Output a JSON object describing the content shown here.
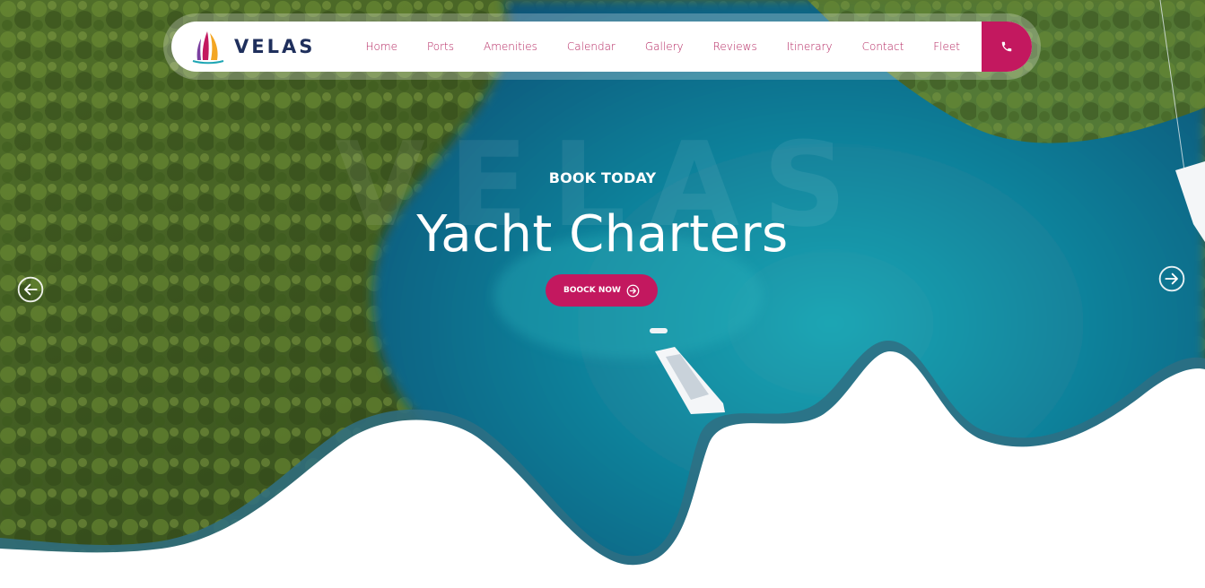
{
  "brand": {
    "name": "VELAS"
  },
  "nav": {
    "items": [
      "Home",
      "Ports",
      "Amenities",
      "Calendar",
      "Gallery",
      "Reviews",
      "Itinerary",
      "Contact",
      "Fleet"
    ],
    "phone_icon": "phone-icon"
  },
  "hero": {
    "watermark": "VELAS",
    "eyebrow": "BOOK TODAY",
    "title": "Yacht Charters",
    "cta_label": "BOOCK NOW",
    "prev_icon": "arrow-left-circle-icon",
    "next_icon": "arrow-right-circle-icon"
  },
  "colors": {
    "accent": "#c3185f",
    "nav_text": "#b4245f",
    "logo_text": "#1f2f5c",
    "water": "#0e6e86",
    "forest": "#3f5a22"
  }
}
